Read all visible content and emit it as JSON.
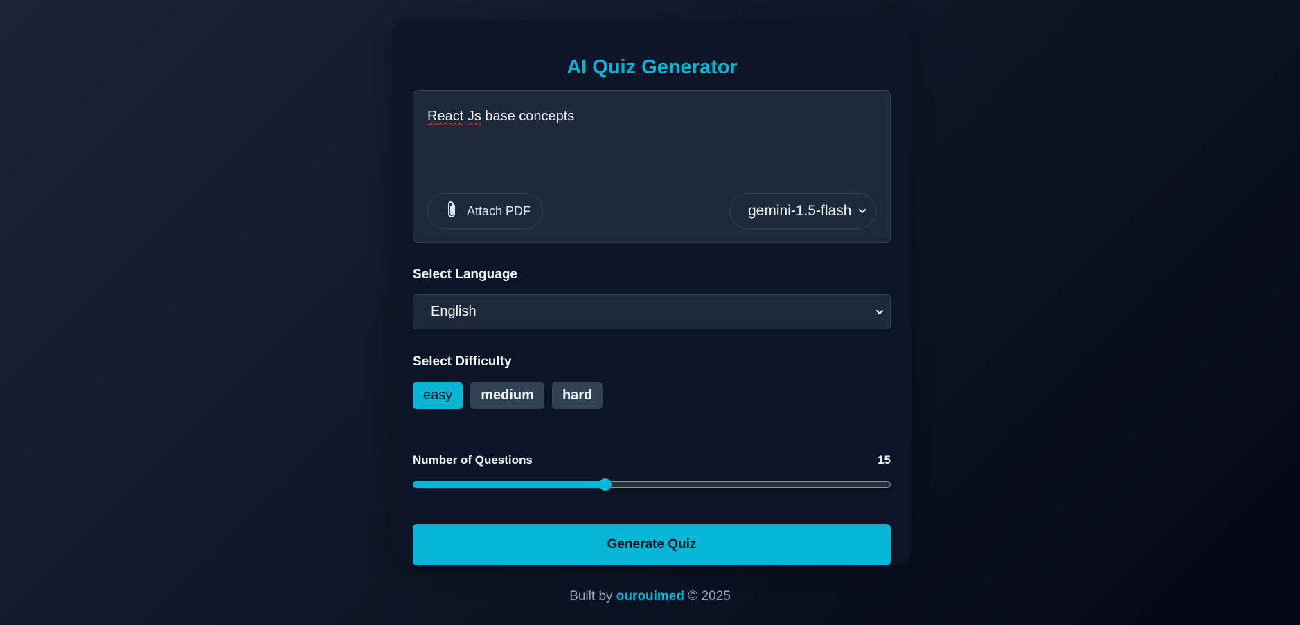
{
  "title": "AI Quiz Generator",
  "prompt": {
    "word1": "React",
    "word2": "Js",
    "rest": " base concepts"
  },
  "attach": {
    "label": "Attach PDF",
    "icon": "paperclip-icon"
  },
  "model": {
    "selected": "gemini-1.5-flash"
  },
  "language": {
    "label": "Select Language",
    "selected": "English"
  },
  "difficulty": {
    "label": "Select Difficulty",
    "options": [
      "easy",
      "medium",
      "hard"
    ],
    "selected": "easy"
  },
  "questions": {
    "label": "Number of Questions",
    "value": "15",
    "fill_fraction": 0.403
  },
  "generate_label": "Generate Quiz",
  "footer": {
    "prefix": "Built by ",
    "author": "ourouimed",
    "suffix": " © 2025"
  },
  "colors": {
    "accent": "#06b6d4",
    "card": "#0b1527",
    "field": "#1e293b"
  }
}
